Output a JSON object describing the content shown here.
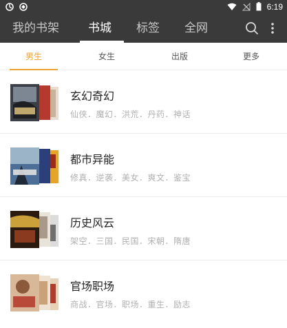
{
  "status": {
    "time": "6:19"
  },
  "nav": {
    "tabs": [
      "我的书架",
      "书城",
      "标签",
      "全网"
    ],
    "active_tab": "书城"
  },
  "sub_tabs": [
    "男生",
    "女生",
    "出版",
    "更多"
  ],
  "categories": [
    {
      "title": "玄幻奇幻",
      "tags": "仙侠．魔幻．洪荒．丹药．神话"
    },
    {
      "title": "都市异能",
      "tags": "修真．逆袭．美女．爽文．鉴宝"
    },
    {
      "title": "历史风云",
      "tags": "架空．三国．民国．宋朝．隋唐"
    },
    {
      "title": "官场职场",
      "tags": "商战．官场．职场．重生．励志"
    }
  ],
  "colors": {
    "nav_bg": "#3a3a3a",
    "accent": "#f0a030"
  }
}
